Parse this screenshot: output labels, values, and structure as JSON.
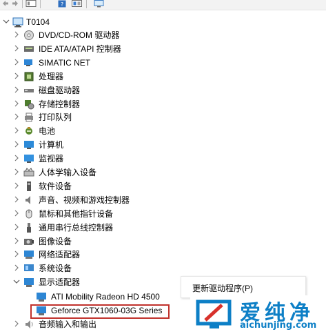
{
  "root": {
    "label": "T0104"
  },
  "devices": [
    {
      "label": "DVD/CD-ROM 驱动器",
      "icon": "dvd-drive-icon"
    },
    {
      "label": "IDE ATA/ATAPI 控制器",
      "icon": "ide-controller-icon"
    },
    {
      "label": "SIMATIC NET",
      "icon": "network-device-icon"
    },
    {
      "label": "处理器",
      "icon": "processor-icon"
    },
    {
      "label": "磁盘驱动器",
      "icon": "disk-drive-icon"
    },
    {
      "label": "存储控制器",
      "icon": "storage-controller-icon"
    },
    {
      "label": "打印队列",
      "icon": "printer-icon"
    },
    {
      "label": "电池",
      "icon": "battery-icon"
    },
    {
      "label": "计算机",
      "icon": "computer-icon"
    },
    {
      "label": "监视器",
      "icon": "monitor-icon"
    },
    {
      "label": "人体学输入设备",
      "icon": "hid-icon"
    },
    {
      "label": "软件设备",
      "icon": "software-device-icon"
    },
    {
      "label": "声音、视频和游戏控制器",
      "icon": "speaker-icon"
    },
    {
      "label": "鼠标和其他指针设备",
      "icon": "mouse-icon"
    },
    {
      "label": "通用串行总线控制器",
      "icon": "usb-icon"
    },
    {
      "label": "图像设备",
      "icon": "camera-icon"
    },
    {
      "label": "网络适配器",
      "icon": "network-adapter-icon"
    },
    {
      "label": "系统设备",
      "icon": "system-device-icon"
    },
    {
      "label": "显示适配器",
      "icon": "display-adapter-icon"
    }
  ],
  "display_children": [
    {
      "label": "ATI Mobility Radeon HD 4500",
      "icon": "display-adapter-icon"
    },
    {
      "label": "Geforce GTX1060-03G Series",
      "icon": "display-adapter-icon"
    }
  ],
  "last_device": {
    "label": "音频输入和输出",
    "icon": "audio-io-icon"
  },
  "context_menu": {
    "update_driver": "更新驱动程序(P)"
  },
  "watermark": {
    "brand_cn": "爱纯净",
    "url": "aichunjing.com"
  },
  "colors": {
    "highlight_border": "#c0312b",
    "watermark_blue": "#0d7fc6"
  }
}
